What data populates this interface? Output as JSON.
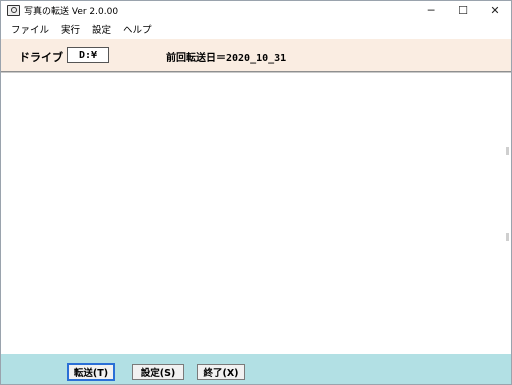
{
  "window": {
    "title": "写真の転送 Ver 2.0.00",
    "controls": {
      "minimize": "─",
      "maximize": "☐",
      "close": "✕"
    },
    "icon": "camera-icon"
  },
  "menu": {
    "items": [
      "ファイル",
      "実行",
      "設定",
      "ヘルプ"
    ]
  },
  "info": {
    "drive_label": "ドライブ",
    "drive_value": "D:¥",
    "last_transfer": "前回転送日＝2020_10_31"
  },
  "footer": {
    "transfer_button": "転送(T)",
    "settings_button": "設定(S)",
    "exit_button": "終了(X)"
  },
  "colors": {
    "info_bg": "#faede2",
    "footer_bg": "#b2e0e4",
    "focus_border": "#2a6fd6"
  }
}
